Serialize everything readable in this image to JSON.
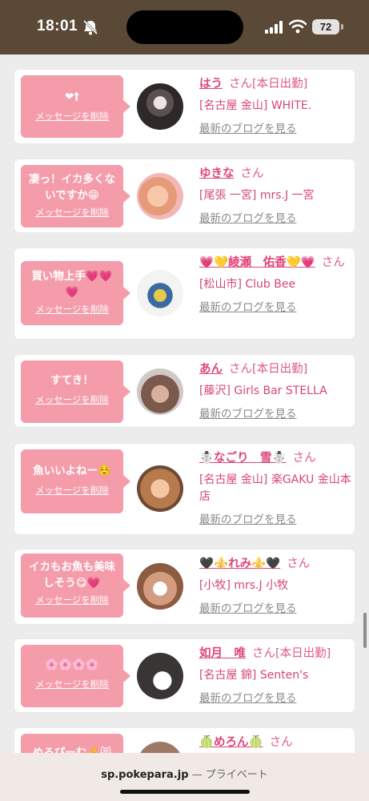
{
  "status_bar": {
    "time": "18:01",
    "battery": "72"
  },
  "feed": {
    "delete_label": "メッセージを削除",
    "san": "さん",
    "blog_link": "最新のブログを見る",
    "items": [
      {
        "message": "❤†",
        "name": "はう",
        "badge": "[本日出勤]",
        "shop": "[名古屋 金山] WHITE."
      },
      {
        "message": "凄っ！イカ多くないですか😁",
        "name": "ゆきな",
        "badge": "",
        "shop": "[尾張 一宮] mrs.J 一宮"
      },
      {
        "message": "買い物上手💗💗💗",
        "name": "💗💛綾瀬　佑香💛💗",
        "badge": "",
        "shop": "[松山市] Club Bee"
      },
      {
        "message": "すてき！",
        "name": "あん",
        "badge": "[本日出勤]",
        "shop": "[藤沢] Girls Bar STELLA"
      },
      {
        "message": "魚いいよねー☺️",
        "name": "☃️なごり　雪☃️",
        "badge": "",
        "shop": "[名古屋 金山] 楽GAKU 金山本店"
      },
      {
        "message": "イカもお魚も美味しそう😋💗",
        "name": "🖤⚜️れみ⚜️🖤",
        "badge": "",
        "shop": "[小牧] mrs.J 小牧"
      },
      {
        "message": "🌸🌸🌸🌸",
        "name": "如月　唯",
        "badge": "[本日出勤]",
        "shop": "[名古屋 錦] Senten's"
      },
      {
        "message": "めろぴーむ✌️😻",
        "name": "🍈めろん🍈",
        "badge": "",
        "shop": ""
      }
    ]
  },
  "browser": {
    "domain": "sp.pokepara.jp",
    "separator": " — ",
    "mode": "プライベート"
  },
  "colors": {
    "header_brown": "#5a4937",
    "bubble_pink": "#f59cab",
    "name_pink": "#e0457c",
    "shop_pink": "#d6457a",
    "link_gray": "#8a8a8a"
  }
}
